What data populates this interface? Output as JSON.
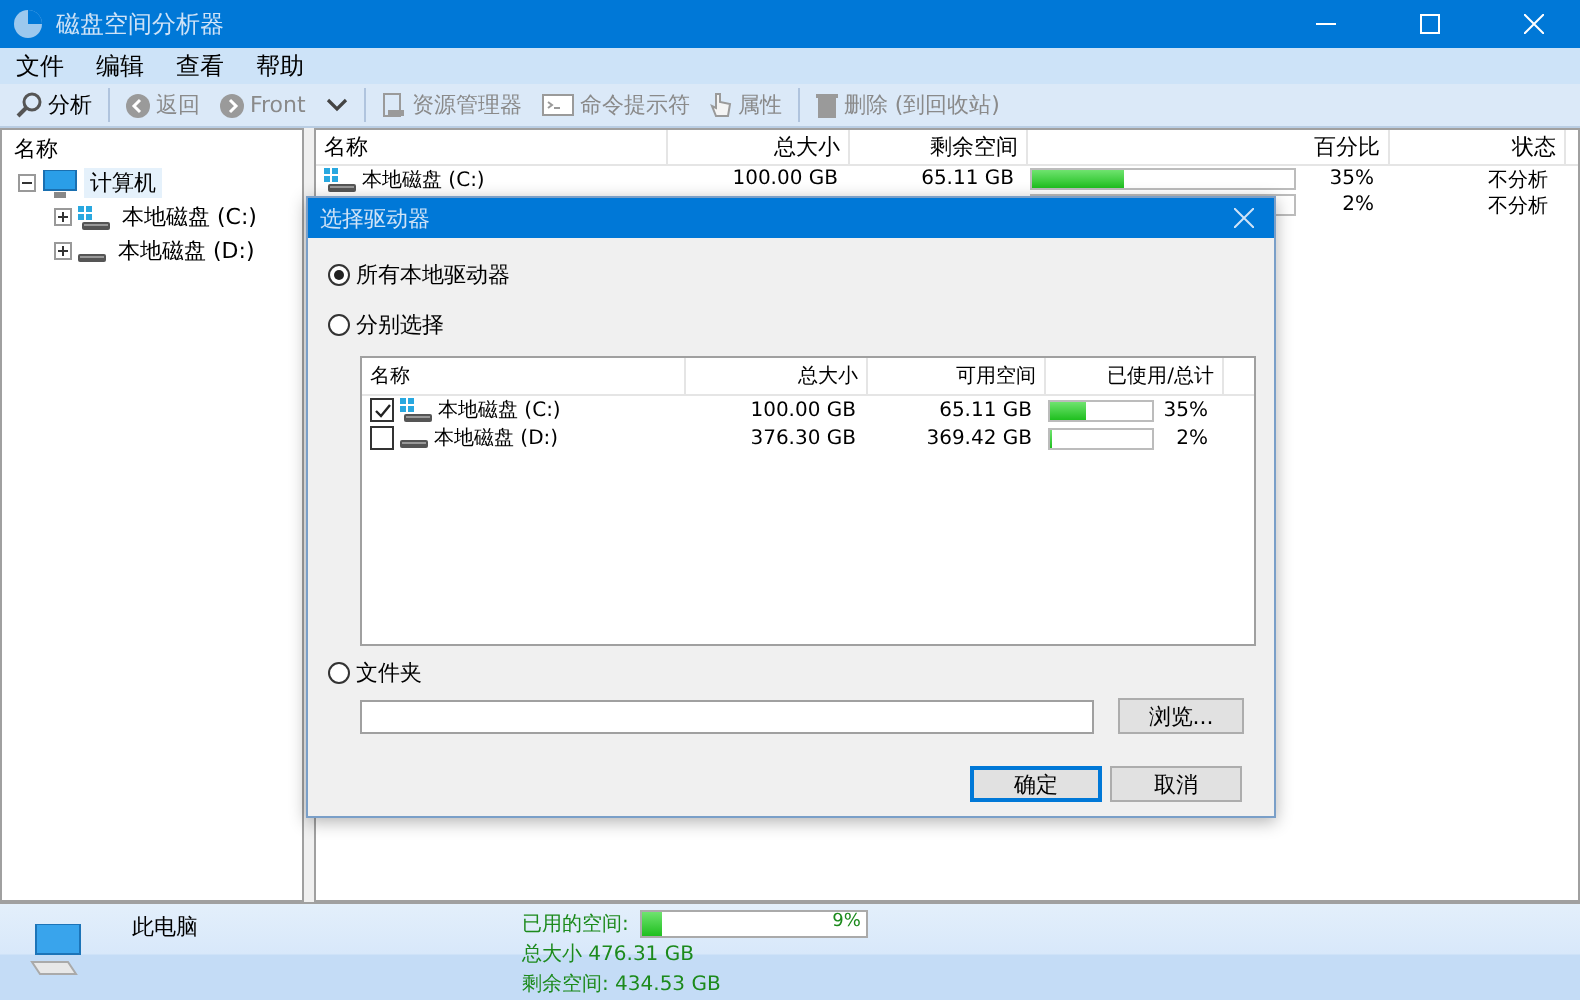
{
  "window": {
    "title": "磁盘空间分析器"
  },
  "menu": [
    "文件",
    "编辑",
    "查看",
    "帮助"
  ],
  "toolbar": [
    [
      {
        "kind": "button",
        "label": "分析",
        "disabled": false
      }
    ],
    [
      {
        "kind": "button",
        "label": "返回",
        "disabled": true
      },
      {
        "kind": "button",
        "label": "Front",
        "disabled": true
      },
      {
        "kind": "dropdown",
        "disabled": false
      }
    ],
    [
      {
        "kind": "button",
        "label": "资源管理器",
        "disabled": true
      },
      {
        "kind": "button",
        "label": "命令提示符",
        "disabled": true
      },
      {
        "kind": "button",
        "label": "属性",
        "disabled": true
      }
    ],
    [
      {
        "kind": "button",
        "label": "删除 (到回收站)",
        "disabled": true
      }
    ]
  ],
  "tree": {
    "header": "名称",
    "items": [
      {
        "label": "计算机",
        "kind": "computer",
        "expanded": true,
        "selected": true,
        "children": [
          {
            "label": "本地磁盘 (C:)",
            "kind": "system_drive",
            "expanded": false,
            "selected": false
          },
          {
            "label": "本地磁盘 (D:)",
            "kind": "drive",
            "expanded": false,
            "selected": false
          }
        ]
      }
    ]
  },
  "drive_list": {
    "columns": [
      "名称",
      "总大小",
      "剩余空间",
      "百分比",
      "状态"
    ],
    "rows": [
      {
        "kind": "system_drive",
        "name": "本地磁盘 (C:)",
        "total": "100.00 GB",
        "free": "65.11 GB",
        "level": 0.35,
        "percent": "35%",
        "status": "不分析"
      },
      {
        "percent": "2%",
        "status": "不分析"
      }
    ]
  },
  "dialog": {
    "title": "选择驱动器",
    "all_drives": {
      "label": "所有本地驱动器",
      "selected": true
    },
    "select_each": {
      "label": "分别选择",
      "selected": false,
      "columns": [
        "名称",
        "总大小",
        "可用空间",
        "已使用/总计"
      ],
      "rows": [
        {
          "kind": "system_drive",
          "checked": true,
          "name": "本地磁盘 (C:)",
          "total": "100.00 GB",
          "free": "65.11 GB",
          "level": 0.35,
          "percent": "35%"
        },
        {
          "kind": "drive",
          "checked": false,
          "name": "本地磁盘 (D:)",
          "total": "376.30 GB",
          "free": "369.42 GB",
          "level": 0.02,
          "percent": "2%"
        }
      ]
    },
    "folder": {
      "label": "文件夹",
      "selected": false,
      "browse_button": "浏览..."
    },
    "buttons": [
      {
        "label": "确定",
        "default": true
      },
      {
        "label": "取消",
        "default": false
      }
    ]
  },
  "status_bar": {
    "label": "此电脑",
    "usage": {
      "label": "已用的空间:",
      "level": 0.09,
      "percent": "9%"
    },
    "total": "总大小 476.31 GB",
    "free": "剩余空间: 434.53 GB"
  }
}
